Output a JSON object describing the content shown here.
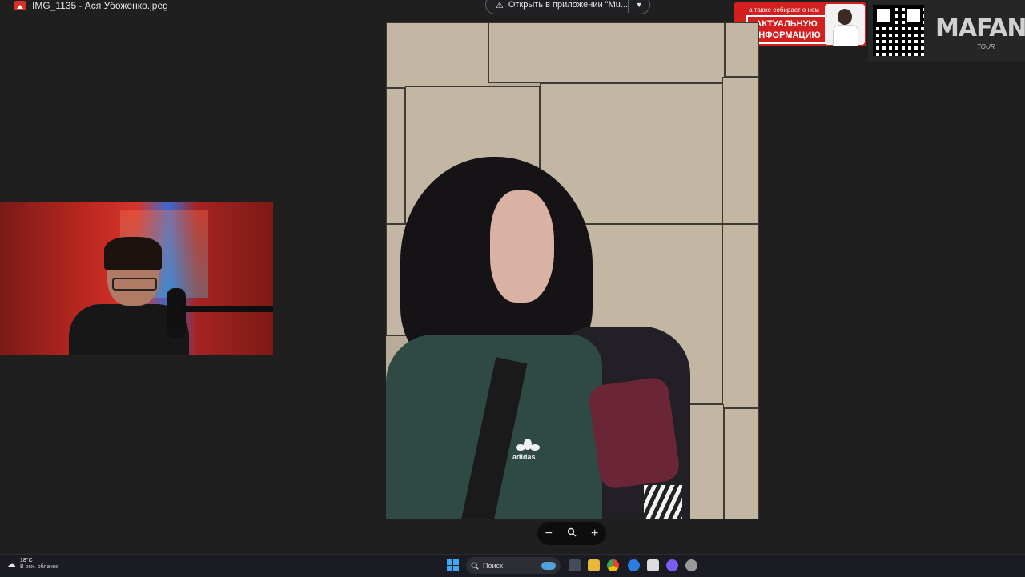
{
  "window": {
    "title": "IMG_1135 - Ася Убоженко.jpeg"
  },
  "toolbar": {
    "open_in_app_label": "Открыть в приложении \"Mu..."
  },
  "promo_banner": {
    "line1": "а также собирает о нем",
    "highlight": "АКТУАЛЬНУЮ ИНФОРМАЦИЮ"
  },
  "brand_banner": {
    "logo_text": "MAFANYA",
    "sub_text": "TOUR"
  },
  "zoom_controls": {
    "zoom_out": "−",
    "zoom_icon": "magnifier-icon",
    "zoom_in": "+"
  },
  "photo": {
    "jacket_brand": "adidas"
  },
  "taskbar": {
    "weather_temp": "18°C",
    "weather_condition": "В осн. облачно",
    "search_placeholder": "Поиск",
    "start_color": "#3fa8f4"
  }
}
